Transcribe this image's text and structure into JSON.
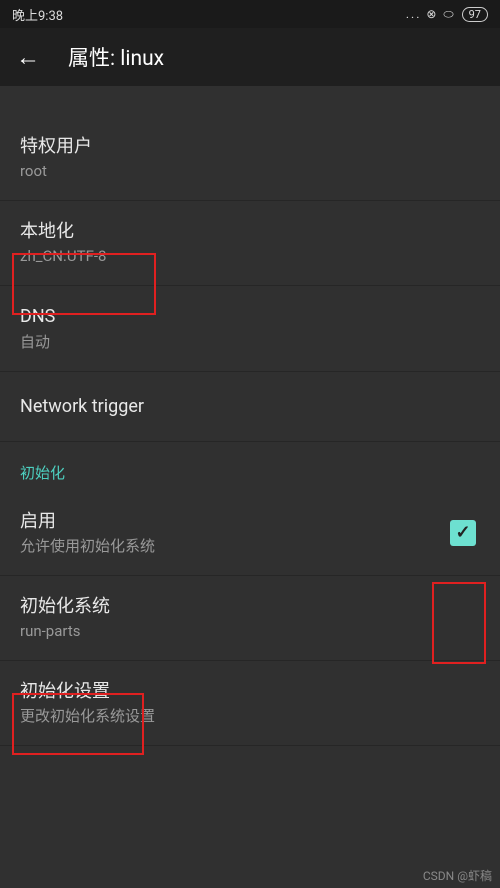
{
  "status_bar": {
    "time": "晚上9:38",
    "battery": "97"
  },
  "header": {
    "title": "属性: linux"
  },
  "items": {
    "privileged_user": {
      "title": "特权用户",
      "subtitle": "root"
    },
    "localization": {
      "title": "本地化",
      "subtitle": "zh_CN.UTF-8"
    },
    "dns": {
      "title": "DNS",
      "subtitle": "自动"
    },
    "network_trigger": {
      "title": "Network trigger"
    }
  },
  "init_section": {
    "header": "初始化",
    "enable": {
      "title": "启用",
      "subtitle": "允许使用初始化系统",
      "checked": true
    },
    "init_system": {
      "title": "初始化系统",
      "subtitle": "run-parts"
    },
    "init_settings": {
      "title": "初始化设置",
      "subtitle": "更改初始化系统设置"
    }
  },
  "watermark": "CSDN @虾稿"
}
